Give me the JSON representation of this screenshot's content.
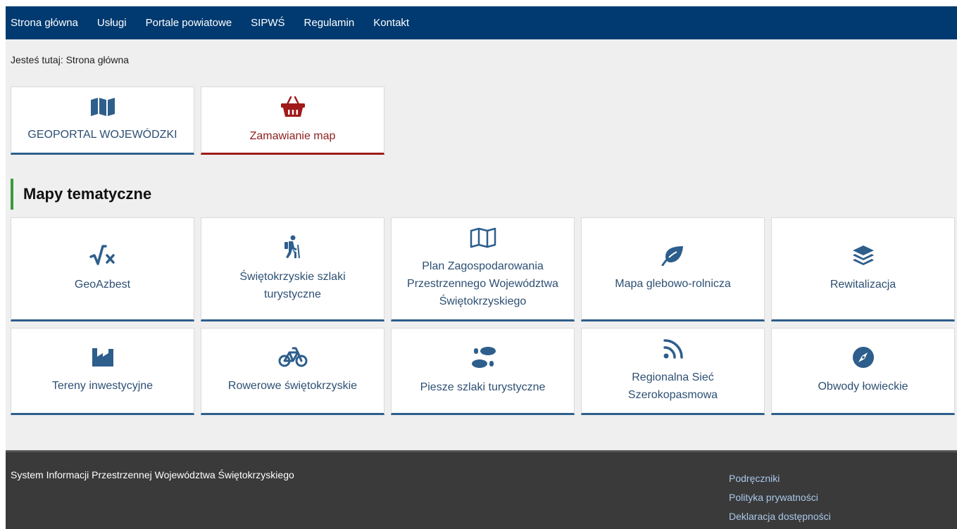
{
  "nav": {
    "items": [
      {
        "label": "Strona główna"
      },
      {
        "label": "Usługi"
      },
      {
        "label": "Portale powiatowe"
      },
      {
        "label": "SIPWŚ"
      },
      {
        "label": "Regulamin"
      },
      {
        "label": "Kontakt"
      }
    ]
  },
  "breadcrumb": "Jesteś tutaj: Strona główna",
  "top_tiles": [
    {
      "label": "GEOPORTAL WOJEWÓDZKI",
      "icon": "map-icon"
    },
    {
      "label": "Zamawianie map",
      "icon": "basket-icon"
    }
  ],
  "section_title": "Mapy tematyczne",
  "tiles": [
    {
      "label": "GeoAzbest",
      "icon": "square-root-icon"
    },
    {
      "label": "Świętokrzyskie szlaki turystyczne",
      "icon": "hiker-icon"
    },
    {
      "label": "Plan Zagospodarowania Przestrzennego Województwa Świętokrzyskiego",
      "icon": "map-outline-icon"
    },
    {
      "label": "Mapa glebowo-rolnicza",
      "icon": "leaf-icon"
    },
    {
      "label": "Rewitalizacja",
      "icon": "layers-icon"
    },
    {
      "label": "Tereny inwestycyjne",
      "icon": "industry-icon"
    },
    {
      "label": "Rowerowe świętokrzyskie",
      "icon": "bicycle-icon"
    },
    {
      "label": "Piesze szlaki turystyczne",
      "icon": "footprints-icon"
    },
    {
      "label": "Regionalna Sieć Szerokopasmowa",
      "icon": "rss-icon"
    },
    {
      "label": "Obwody łowieckie",
      "icon": "compass-icon"
    }
  ],
  "footer": {
    "title": "System Informacji Przestrzennej Województwa Świętokrzyskiego",
    "links": [
      {
        "label": "Podręczniki"
      },
      {
        "label": "Polityka prywatności"
      },
      {
        "label": "Deklaracja dostępności"
      }
    ]
  },
  "colors": {
    "nav_bg": "#003a70",
    "tile_border": "#2d5e8c",
    "accent_red": "#a01a1a",
    "section_accent": "#3a9a3a",
    "footer_bg": "#3a3a3a",
    "footer_link": "#a9c8ea"
  }
}
